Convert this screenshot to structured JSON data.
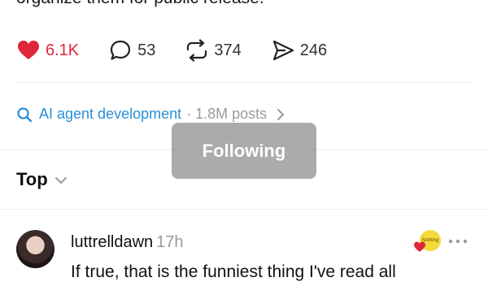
{
  "post": {
    "text_tail": "organize them for public release."
  },
  "actions": {
    "likes": {
      "icon": "heart-icon",
      "count": "6.1K",
      "color": "#e0263a"
    },
    "comments": {
      "icon": "comment-icon",
      "count": "53"
    },
    "reposts": {
      "icon": "repost-icon",
      "count": "374"
    },
    "shares": {
      "icon": "send-icon",
      "count": "246"
    }
  },
  "topic": {
    "icon": "search-icon",
    "name": "AI agent development",
    "meta": "· 1.8M posts",
    "color": "#2a8fd6"
  },
  "toast": {
    "label": "Following"
  },
  "sort": {
    "label": "Top"
  },
  "reply": {
    "username": "luttrelldawn",
    "time": "17h",
    "text": "If true, that is the funniest thing I've read all",
    "sticker_text": "Nothing"
  }
}
